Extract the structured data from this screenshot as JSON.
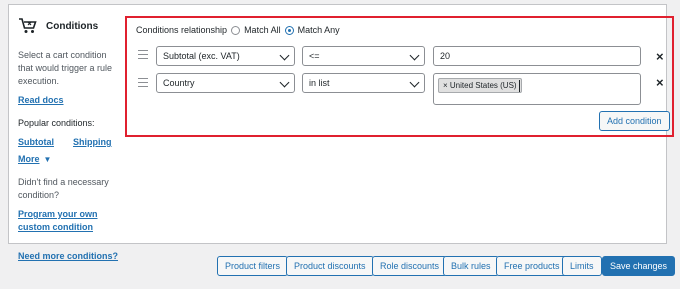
{
  "sidebar": {
    "title": "Conditions",
    "description": "Select a cart condition that would trigger a rule execution.",
    "read_docs": "Read docs",
    "popular_label": "Popular conditions:",
    "popular_links": [
      "Subtotal",
      "Shipping"
    ],
    "more": "More",
    "not_found": "Didn't find a necessary condition?",
    "program_link": "Program your own custom condition",
    "need_more": "Need more conditions?"
  },
  "conditions": {
    "relationship_label": "Conditions relationship",
    "match_all": "Match All",
    "match_any": "Match Any",
    "selected": "Match Any",
    "rows": [
      {
        "field": "Subtotal (exc. VAT)",
        "operator": "<=",
        "value": "20"
      },
      {
        "field": "Country",
        "operator": "in list",
        "tag": "× United States (US)"
      }
    ],
    "add_condition": "Add condition",
    "remove_symbol": "×"
  },
  "bottom_buttons": [
    "Product filters",
    "Product discounts",
    "Role discounts",
    "Bulk rules",
    "Free products",
    "Limits",
    "Save changes"
  ],
  "colors": {
    "accent": "#2271b1",
    "highlight_border": "#e0202f"
  },
  "icons": {
    "sidebar": "cart-icon"
  }
}
